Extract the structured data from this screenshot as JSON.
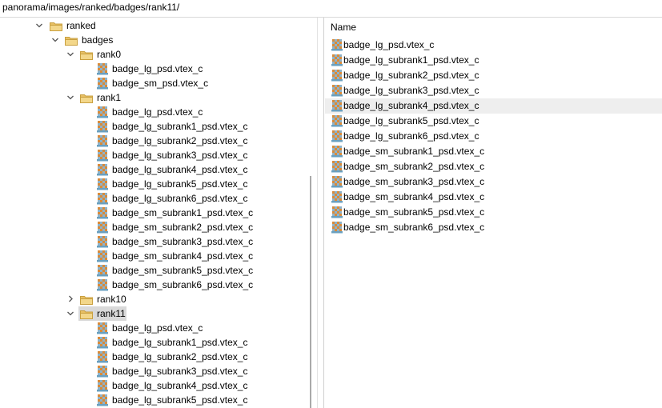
{
  "path": "panorama/images/ranked/badges/rank11/",
  "tree": {
    "ranked": "ranked",
    "badges": "badges",
    "rank0": {
      "label": "rank0",
      "files": [
        "badge_lg_psd.vtex_c",
        "badge_sm_psd.vtex_c"
      ]
    },
    "rank1": {
      "label": "rank1",
      "files": [
        "badge_lg_psd.vtex_c",
        "badge_lg_subrank1_psd.vtex_c",
        "badge_lg_subrank2_psd.vtex_c",
        "badge_lg_subrank3_psd.vtex_c",
        "badge_lg_subrank4_psd.vtex_c",
        "badge_lg_subrank5_psd.vtex_c",
        "badge_lg_subrank6_psd.vtex_c",
        "badge_sm_subrank1_psd.vtex_c",
        "badge_sm_subrank2_psd.vtex_c",
        "badge_sm_subrank3_psd.vtex_c",
        "badge_sm_subrank4_psd.vtex_c",
        "badge_sm_subrank5_psd.vtex_c",
        "badge_sm_subrank6_psd.vtex_c"
      ]
    },
    "rank10": {
      "label": "rank10"
    },
    "rank11": {
      "label": "rank11",
      "files": [
        "badge_lg_psd.vtex_c",
        "badge_lg_subrank1_psd.vtex_c",
        "badge_lg_subrank2_psd.vtex_c",
        "badge_lg_subrank3_psd.vtex_c",
        "badge_lg_subrank4_psd.vtex_c",
        "badge_lg_subrank5_psd.vtex_c"
      ]
    }
  },
  "list": {
    "header": "Name",
    "files": [
      "badge_lg_psd.vtex_c",
      "badge_lg_subrank1_psd.vtex_c",
      "badge_lg_subrank2_psd.vtex_c",
      "badge_lg_subrank3_psd.vtex_c",
      "badge_lg_subrank4_psd.vtex_c",
      "badge_lg_subrank5_psd.vtex_c",
      "badge_lg_subrank6_psd.vtex_c",
      "badge_sm_subrank1_psd.vtex_c",
      "badge_sm_subrank2_psd.vtex_c",
      "badge_sm_subrank3_psd.vtex_c",
      "badge_sm_subrank4_psd.vtex_c",
      "badge_sm_subrank5_psd.vtex_c",
      "badge_sm_subrank6_psd.vtex_c"
    ],
    "hovered_index": 4
  },
  "colors": {
    "folder": "#e8c065",
    "selection": "#d9d9d9",
    "hover": "#eeeeee"
  }
}
